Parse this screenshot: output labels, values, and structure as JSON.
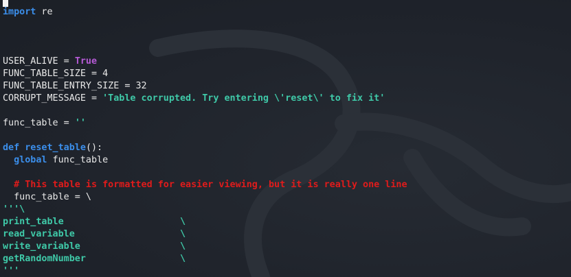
{
  "editor": {
    "lines": [
      [
        {
          "t": "import",
          "c": "kw"
        },
        {
          "t": " re",
          "c": "plain"
        }
      ],
      [],
      [],
      [],
      [
        {
          "t": "USER_ALIVE = ",
          "c": "plain"
        },
        {
          "t": "True",
          "c": "const"
        }
      ],
      [
        {
          "t": "FUNC_TABLE_SIZE = 4",
          "c": "plain"
        }
      ],
      [
        {
          "t": "FUNC_TABLE_ENTRY_SIZE = 32",
          "c": "plain"
        }
      ],
      [
        {
          "t": "CORRUPT_MESSAGE = ",
          "c": "plain"
        },
        {
          "t": "'Table corrupted. Try entering \\'reset\\' to fix it'",
          "c": "str"
        }
      ],
      [],
      [
        {
          "t": "func_table = ",
          "c": "plain"
        },
        {
          "t": "''",
          "c": "str"
        }
      ],
      [],
      [
        {
          "t": "def",
          "c": "kw"
        },
        {
          "t": " ",
          "c": "plain"
        },
        {
          "t": "reset_table",
          "c": "fn"
        },
        {
          "t": "():",
          "c": "plain"
        }
      ],
      [
        {
          "t": "  ",
          "c": "plain"
        },
        {
          "t": "global",
          "c": "kw"
        },
        {
          "t": " func_table",
          "c": "plain"
        }
      ],
      [],
      [
        {
          "t": "  ",
          "c": "plain"
        },
        {
          "t": "# This table is formatted for easier viewing, but it is really one line",
          "c": "cmt"
        }
      ],
      [
        {
          "t": "  func_table = \\",
          "c": "plain"
        }
      ],
      [
        {
          "t": "'''\\",
          "c": "str"
        }
      ],
      [
        {
          "t": "print_table                     \\",
          "c": "str"
        }
      ],
      [
        {
          "t": "read_variable                   \\",
          "c": "str"
        }
      ],
      [
        {
          "t": "write_variable                  \\",
          "c": "str"
        }
      ],
      [
        {
          "t": "getRandomNumber                 \\",
          "c": "str"
        }
      ],
      [
        {
          "t": "'''",
          "c": "str"
        }
      ]
    ]
  }
}
